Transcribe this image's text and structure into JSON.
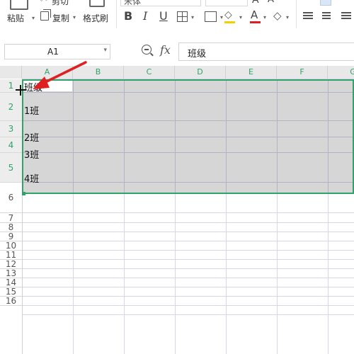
{
  "ribbon": {
    "clipboard": {
      "cut": "剪切",
      "paste": "粘贴",
      "copy": "复制",
      "format_painter": "格式刷"
    },
    "font": {
      "name": "宋体"
    },
    "format_buttons": [
      "B",
      "I",
      "U"
    ]
  },
  "formula_bar": {
    "name_box": "A1",
    "zoom_icon": "zoom-icon",
    "fx_label": "fx",
    "content": "班级"
  },
  "sheet": {
    "columns": [
      "A",
      "B",
      "C",
      "D",
      "E",
      "F",
      "G"
    ],
    "rows": [
      "1",
      "2",
      "3",
      "4",
      "5",
      "6",
      "7",
      "8",
      "9",
      "10",
      "11",
      "12",
      "13",
      "14",
      "15",
      "16"
    ],
    "cells": {
      "A1": "班级",
      "A2": "1班",
      "A3": "2班",
      "A4": "3班",
      "A5": "4班"
    },
    "selection": "A1:G5",
    "selection_color": "#2fa36a"
  },
  "annotation": {
    "arrow_color": "#e02020"
  }
}
